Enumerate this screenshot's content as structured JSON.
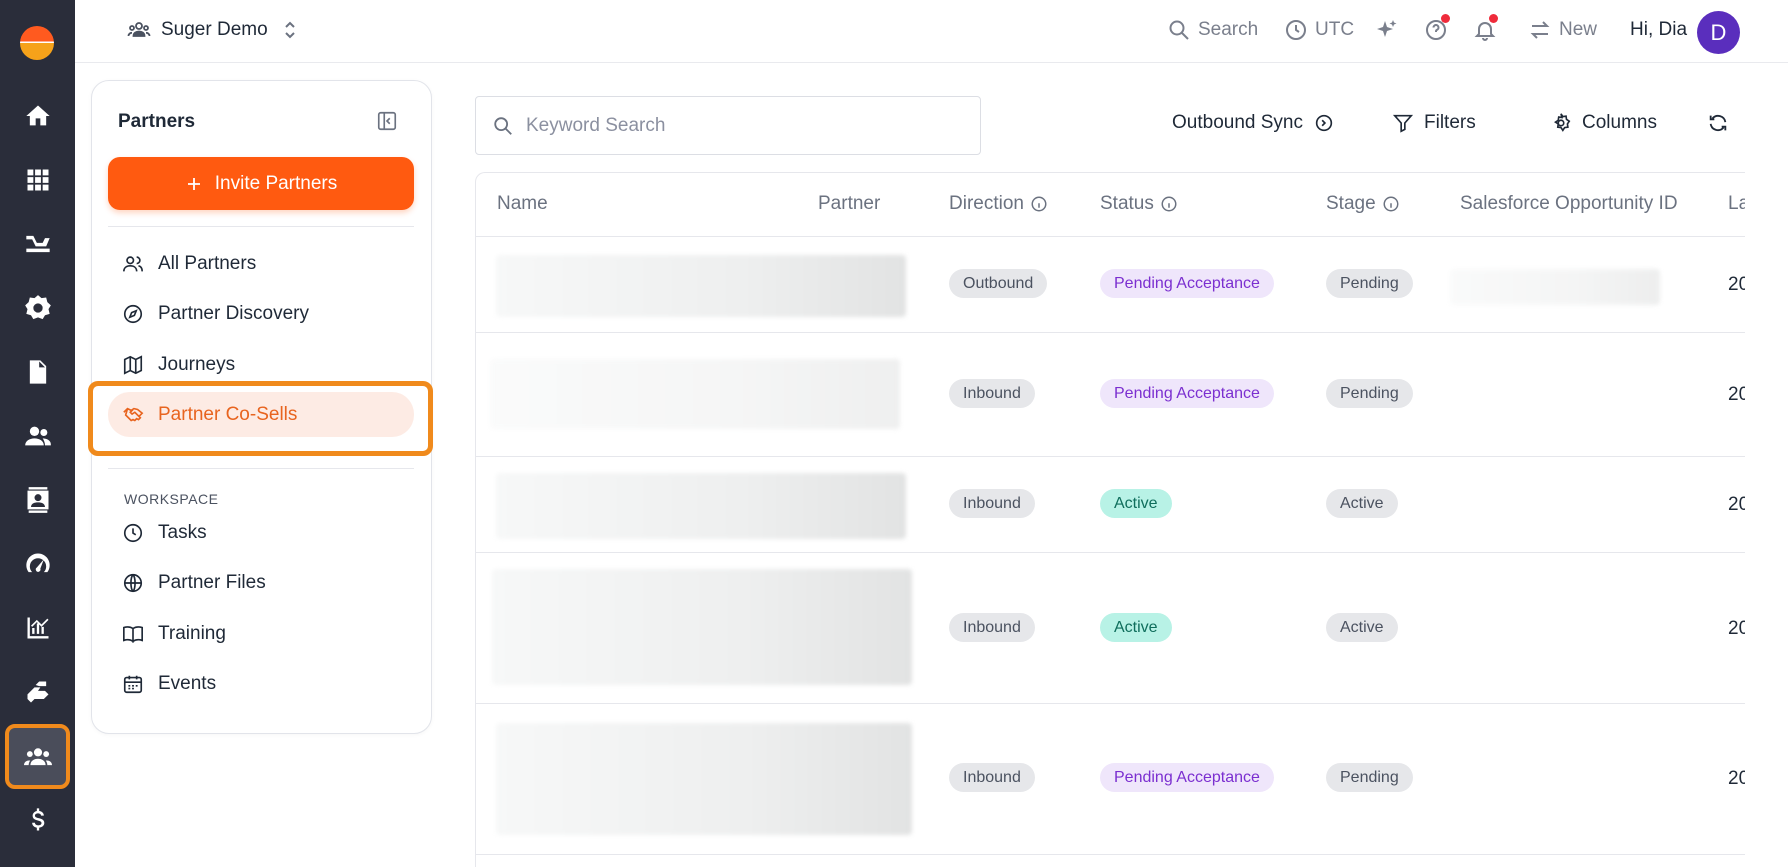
{
  "header": {
    "workspace": "Suger Demo",
    "search_label": "Search",
    "timezone": "UTC",
    "new_label": "New",
    "greeting": "Hi, Dia",
    "avatar_initial": "D"
  },
  "rail": {
    "items": [
      "home-icon",
      "apps-icon",
      "offers-icon",
      "settings-icon",
      "document-icon",
      "people-icon",
      "contact-card-icon",
      "gauge-icon",
      "analytics-icon",
      "integrations-icon",
      "partners-icon",
      "dollar-icon"
    ],
    "active": "partners-icon"
  },
  "panel": {
    "title": "Partners",
    "invite_label": "Invite Partners",
    "nav": [
      {
        "label": "All Partners",
        "icon": "users-icon"
      },
      {
        "label": "Partner Discovery",
        "icon": "compass-icon"
      },
      {
        "label": "Journeys",
        "icon": "map-icon"
      },
      {
        "label": "Partner Co-Sells",
        "icon": "handshake-icon",
        "active": true
      }
    ],
    "workspace_label": "WORKSPACE",
    "workspace_nav": [
      {
        "label": "Tasks",
        "icon": "clock-icon"
      },
      {
        "label": "Partner Files",
        "icon": "globe-icon"
      },
      {
        "label": "Training",
        "icon": "book-icon"
      },
      {
        "label": "Events",
        "icon": "calendar-icon"
      }
    ]
  },
  "toolbar": {
    "search_placeholder": "Keyword Search",
    "outbound_sync": "Outbound Sync",
    "filters": "Filters",
    "columns": "Columns"
  },
  "table": {
    "columns": [
      "Name",
      "Partner",
      "Direction",
      "Status",
      "Stage",
      "Salesforce Opportunity ID",
      "La"
    ],
    "rows": [
      {
        "direction": "Outbound",
        "status": "Pending Acceptance",
        "stage": "Pending",
        "last": "20"
      },
      {
        "direction": "Inbound",
        "status": "Pending Acceptance",
        "stage": "Pending",
        "last": "20"
      },
      {
        "direction": "Inbound",
        "status": "Active",
        "stage": "Active",
        "last": "20"
      },
      {
        "direction": "Inbound",
        "status": "Active",
        "stage": "Active",
        "last": "20"
      },
      {
        "direction": "Inbound",
        "status": "Pending Acceptance",
        "stage": "Pending",
        "last": "20"
      }
    ]
  },
  "colors": {
    "rail_bg": "#2a2d3a",
    "accent": "#ff5a10",
    "highlight": "#f08a1c",
    "status_purple": "#7b2fd0",
    "status_teal": "#0f6e5c"
  }
}
